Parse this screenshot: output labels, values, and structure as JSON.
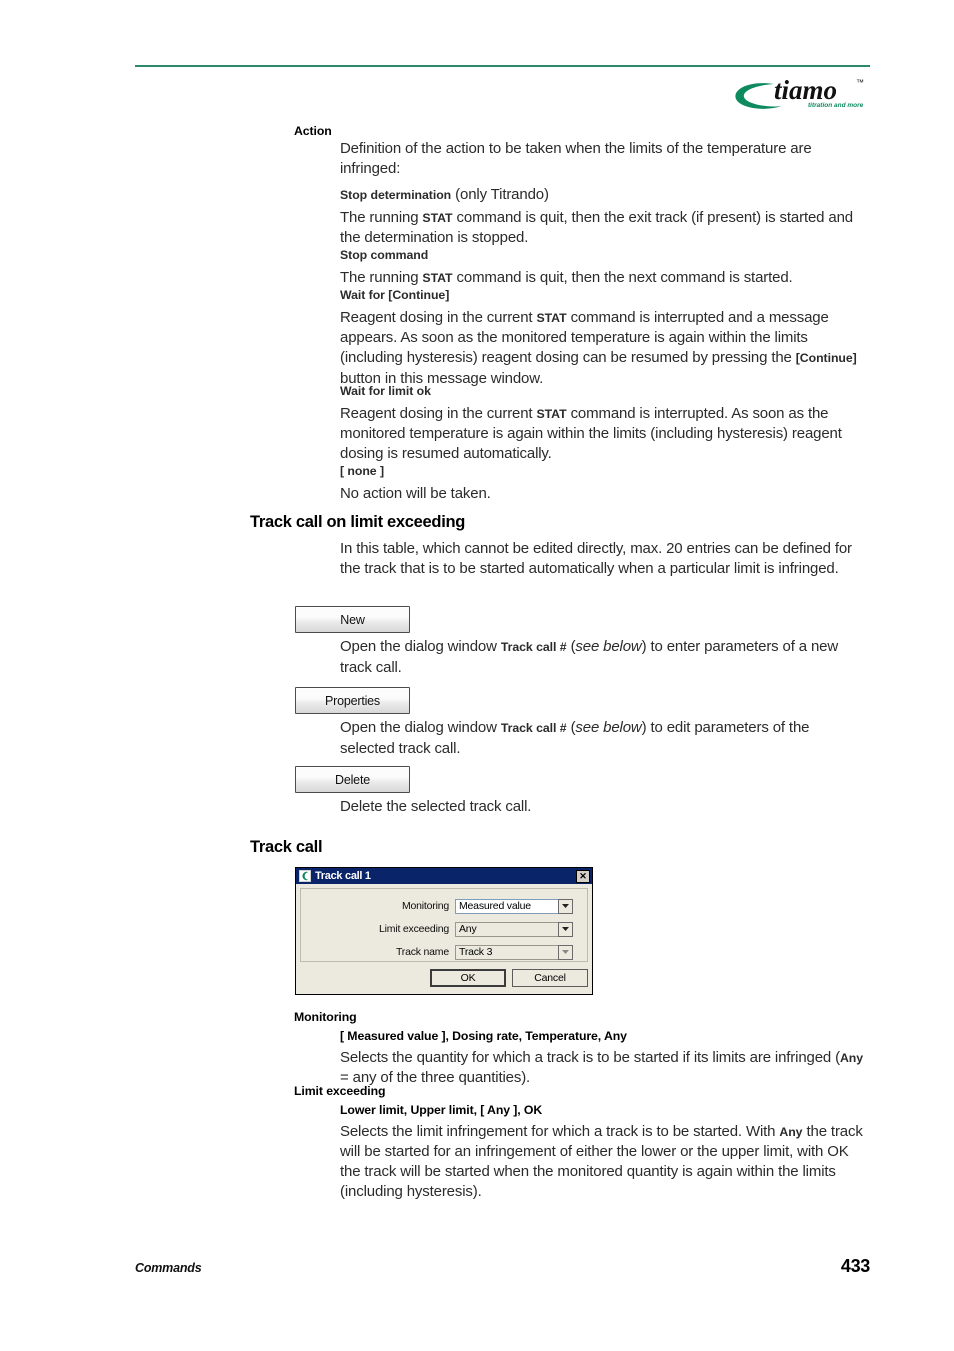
{
  "header": {
    "logo_name": "tiamo",
    "logo_tagline": "titration and more",
    "logo_tm": "™",
    "accent_green": "#2d8a68"
  },
  "sections": {
    "action": {
      "label": "Action",
      "intro": "Definition of the action to be taken when the limits of the temperature are infringed:",
      "items": [
        {
          "term": "Stop determination",
          "term_suffix": " (only Titrando)",
          "body_pre": "The running ",
          "body_kw": "STAT",
          "body_post": " command is quit, then the exit track (if present) is started and the determination is stopped."
        },
        {
          "term": "Stop command",
          "term_suffix": "",
          "body_pre": "The running ",
          "body_kw": "STAT",
          "body_post": " command is quit, then the next command is started."
        },
        {
          "term": "Wait for [Continue]",
          "term_suffix": "",
          "body_pre": "Reagent dosing in the current ",
          "body_kw": "STAT",
          "body_post": " command is interrupted and a message appears. As soon as the monitored temperature is again within the limits (including hysteresis) reagent dosing can be resumed by pressing the ",
          "body_kw2": "[Continue]",
          "body_post2": " button in this message window."
        },
        {
          "term": "Wait for limit ok",
          "term_suffix": "",
          "body_pre": "Reagent dosing in the current ",
          "body_kw": "STAT",
          "body_post": " command is interrupted. As soon as the monitored temperature is again within the limits (including hysteresis) reagent dosing is resumed automatically."
        },
        {
          "term": "[ none ]",
          "term_suffix": "",
          "body_pre": "No action will be taken.",
          "body_kw": "",
          "body_post": ""
        }
      ]
    },
    "track_call_on_limit_exceeding": {
      "heading": "Track call on limit exceeding",
      "intro": "In this table, which cannot be edited directly, max. 20 entries can be defined for the track that is to be started automatically when a particular limit is infringed.",
      "buttons": [
        {
          "label": "New",
          "desc_pre": "Open the dialog window ",
          "desc_kw": "Track call #",
          "desc_mid": " (",
          "desc_italic": "see below",
          "desc_post": ") to enter parameters of a new track call."
        },
        {
          "label": "Properties",
          "desc_pre": "Open the dialog window ",
          "desc_kw": "Track call #",
          "desc_mid": " (",
          "desc_italic": "see below",
          "desc_post": ") to edit parameters of the selected track call."
        },
        {
          "label": "Delete",
          "desc_pre": "Delete the selected track call.",
          "desc_kw": "",
          "desc_mid": "",
          "desc_italic": "",
          "desc_post": ""
        }
      ]
    },
    "track_call": {
      "heading": "Track call"
    }
  },
  "dialog": {
    "title": "Track call 1",
    "close_label": "✕",
    "fields": [
      {
        "label": "Monitoring",
        "value": "Measured value",
        "style": "focused"
      },
      {
        "label": "Limit exceeding",
        "value": "Any",
        "style": "normal"
      },
      {
        "label": "Track name",
        "value": "Track 3",
        "style": "disabled"
      }
    ],
    "ok_label": "OK",
    "cancel_label": "Cancel",
    "titlebar_color": "#0a246a"
  },
  "params": {
    "monitoring": {
      "label": "Monitoring",
      "options": "[ Measured value ], Dosing rate, Temperature, Any",
      "desc_pre": "Selects the quantity for which a track is to be started if its limits are infringed (",
      "desc_kw": "Any",
      "desc_post": " = any of the three quantities)."
    },
    "limit_exceeding": {
      "label": "Limit exceeding",
      "options": "Lower limit,  Upper limit, [ Any ], OK",
      "desc_pre": "Selects the limit infringement for which a track is to be started. With ",
      "desc_kw": "Any",
      "desc_post": " the track will be started for an infringement of either the lower or the upper limit, with OK the track will be started when the monitored quantity is again within the limits (including hysteresis)."
    }
  },
  "footer": {
    "chapter": "Commands",
    "page_number": "433"
  }
}
